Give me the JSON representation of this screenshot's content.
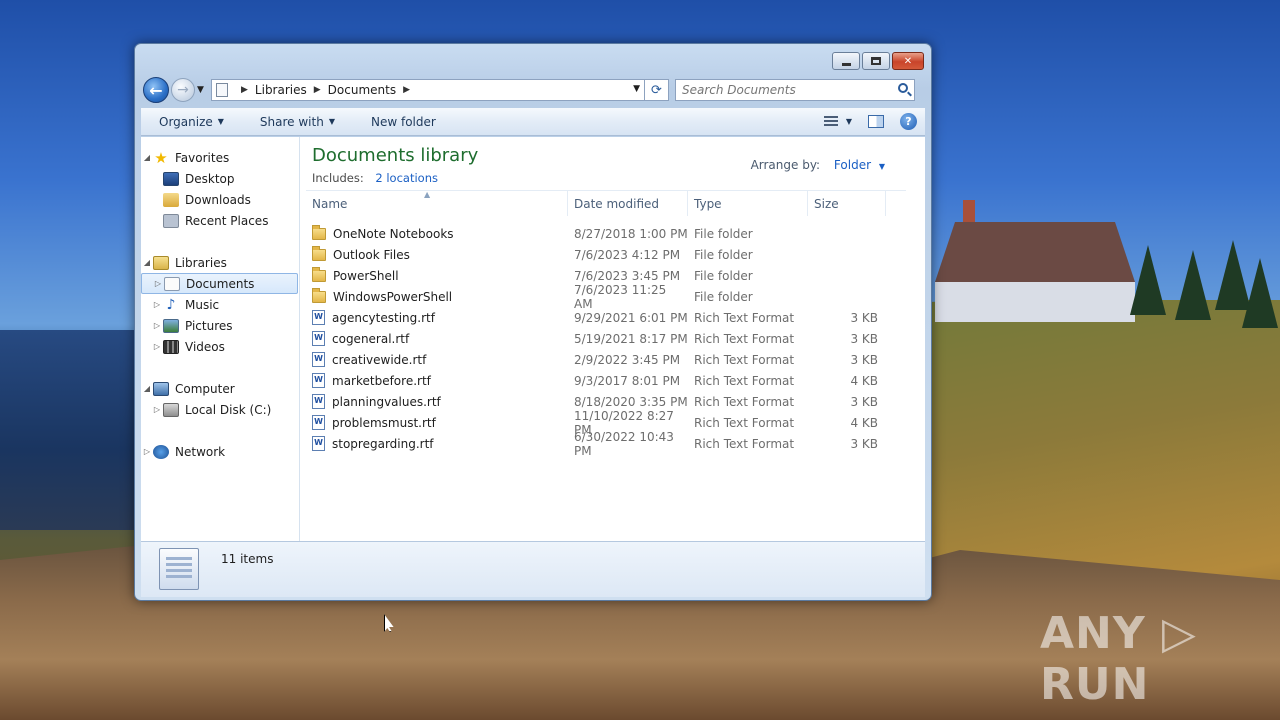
{
  "window": {
    "close_glyph": "✕"
  },
  "address": {
    "crumbs": [
      "Libraries",
      "Documents"
    ],
    "search_placeholder": "Search Documents"
  },
  "toolbar": {
    "organize": "Organize",
    "share_with": "Share with",
    "new_folder": "New folder"
  },
  "nav": {
    "favorites": "Favorites",
    "desktop": "Desktop",
    "downloads": "Downloads",
    "recent_places": "Recent Places",
    "libraries": "Libraries",
    "documents": "Documents",
    "music": "Music",
    "pictures": "Pictures",
    "videos": "Videos",
    "computer": "Computer",
    "local_disk": "Local Disk (C:)",
    "network": "Network"
  },
  "library": {
    "title": "Documents library",
    "includes_label": "Includes:",
    "includes_link": "2 locations",
    "arrange_label": "Arrange by:",
    "arrange_value": "Folder"
  },
  "columns": {
    "name": "Name",
    "date": "Date modified",
    "type": "Type",
    "size": "Size"
  },
  "files": [
    {
      "name": "OneNote Notebooks",
      "date": "8/27/2018 1:00 PM",
      "type": "File folder",
      "size": "",
      "kind": "folder"
    },
    {
      "name": "Outlook Files",
      "date": "7/6/2023 4:12 PM",
      "type": "File folder",
      "size": "",
      "kind": "folder"
    },
    {
      "name": "PowerShell",
      "date": "7/6/2023 3:45 PM",
      "type": "File folder",
      "size": "",
      "kind": "folder"
    },
    {
      "name": "WindowsPowerShell",
      "date": "7/6/2023 11:25 AM",
      "type": "File folder",
      "size": "",
      "kind": "folder"
    },
    {
      "name": "agencytesting.rtf",
      "date": "9/29/2021 6:01 PM",
      "type": "Rich Text Format",
      "size": "3 KB",
      "kind": "rtf"
    },
    {
      "name": "cogeneral.rtf",
      "date": "5/19/2021 8:17 PM",
      "type": "Rich Text Format",
      "size": "3 KB",
      "kind": "rtf"
    },
    {
      "name": "creativewide.rtf",
      "date": "2/9/2022 3:45 PM",
      "type": "Rich Text Format",
      "size": "3 KB",
      "kind": "rtf"
    },
    {
      "name": "marketbefore.rtf",
      "date": "9/3/2017 8:01 PM",
      "type": "Rich Text Format",
      "size": "4 KB",
      "kind": "rtf"
    },
    {
      "name": "planningvalues.rtf",
      "date": "8/18/2020 3:35 PM",
      "type": "Rich Text Format",
      "size": "3 KB",
      "kind": "rtf"
    },
    {
      "name": "problemsmust.rtf",
      "date": "11/10/2022 8:27 PM",
      "type": "Rich Text Format",
      "size": "4 KB",
      "kind": "rtf"
    },
    {
      "name": "stopregarding.rtf",
      "date": "6/30/2022 10:43 PM",
      "type": "Rich Text Format",
      "size": "3 KB",
      "kind": "rtf"
    }
  ],
  "details": {
    "count": "11 items"
  },
  "desktop": {
    "watermark": "ANY ▷ RUN"
  }
}
